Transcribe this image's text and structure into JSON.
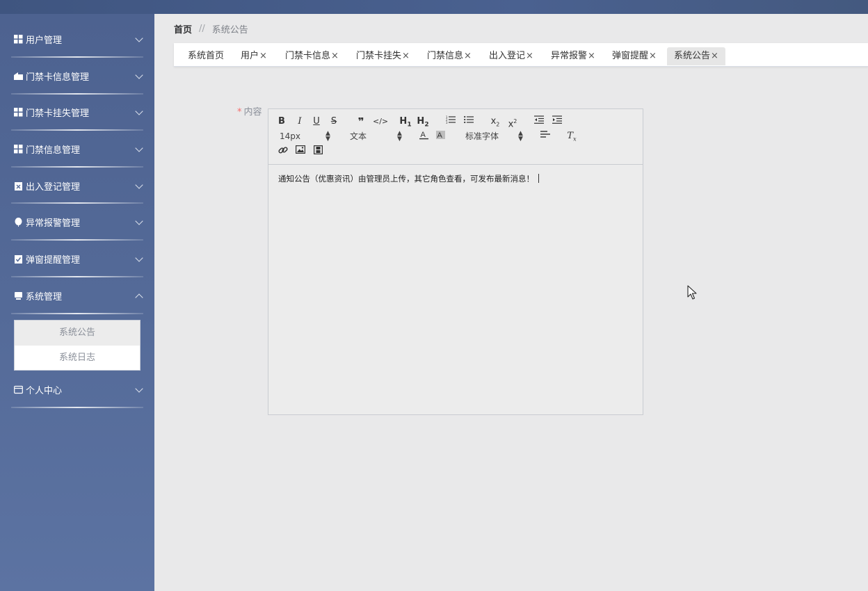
{
  "sidebar": {
    "items": [
      {
        "label": "用户管理",
        "icon": "grid-icon"
      },
      {
        "label": "门禁卡信息管理",
        "icon": "building-icon"
      },
      {
        "label": "门禁卡挂失管理",
        "icon": "grid-icon"
      },
      {
        "label": "门禁信息管理",
        "icon": "grid-icon"
      },
      {
        "label": "出入登记管理",
        "icon": "clipboard-icon"
      },
      {
        "label": "异常报警管理",
        "icon": "balloon-icon"
      },
      {
        "label": "弹窗提醒管理",
        "icon": "clipboard-check-icon"
      },
      {
        "label": "系统管理",
        "icon": "monitor-icon"
      },
      {
        "label": "个人中心",
        "icon": "card-icon"
      }
    ],
    "submenu": [
      {
        "label": "系统公告"
      },
      {
        "label": "系统日志"
      }
    ]
  },
  "breadcrumb": {
    "home": "首页",
    "separator": "//",
    "current": "系统公告"
  },
  "tabs": [
    {
      "label": "系统首页",
      "closable": ""
    },
    {
      "label": "用户",
      "closable": "×"
    },
    {
      "label": "门禁卡信息",
      "closable": "×"
    },
    {
      "label": "门禁卡挂失",
      "closable": "×"
    },
    {
      "label": "门禁信息",
      "closable": "×"
    },
    {
      "label": "出入登记",
      "closable": "×"
    },
    {
      "label": "异常报警",
      "closable": "×"
    },
    {
      "label": "弹窗提醒",
      "closable": "×"
    },
    {
      "label": "系统公告",
      "closable": "×"
    }
  ],
  "form": {
    "required_mark": "*",
    "content_label": "内容"
  },
  "editor": {
    "font_size": "14px",
    "header": "文本",
    "font": "标准字体",
    "content": "通知公告（优惠资讯）由管理员上传，其它角色查看，可发布最新消息！"
  }
}
